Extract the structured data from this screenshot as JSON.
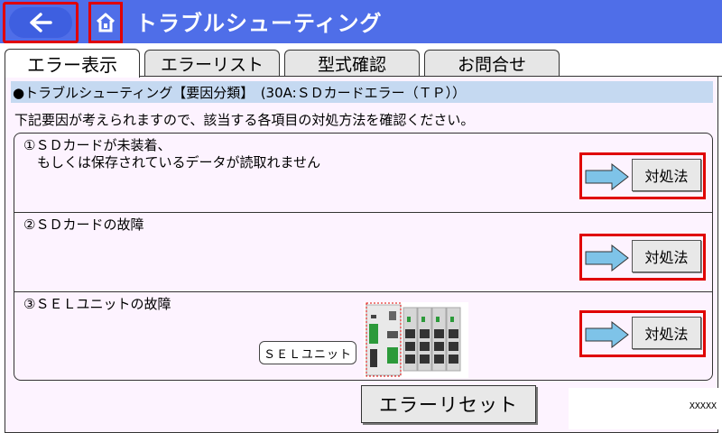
{
  "header": {
    "title": "トラブルシューティング",
    "back_icon": "arrow-left-icon",
    "home_icon": "home-icon",
    "bg_color": "#4f6ee8"
  },
  "tabs": [
    {
      "label": "エラー表示",
      "active": true
    },
    {
      "label": "エラーリスト",
      "active": false
    },
    {
      "label": "型式確認",
      "active": false
    },
    {
      "label": "お問合せ",
      "active": false
    }
  ],
  "main": {
    "category": "●トラブルシューティング【要因分類】　(30A:ＳＤカードエラー（ＴＰ））",
    "instruction": "下記要因が考えられますので、該当する各項目の対処方法を確認ください。",
    "causes": [
      {
        "line1": "①ＳＤカードが未装着、",
        "line2": "　もしくは保存されているデータが読取れません",
        "action_label": "対処法"
      },
      {
        "line1": "②ＳＤカードの故障",
        "line2": "",
        "action_label": "対処法"
      },
      {
        "line1": "③ＳＥＬユニットの故障",
        "line2": "",
        "action_label": "対処法"
      }
    ],
    "sel_unit_label": "ＳＥＬユニット",
    "reset_label": "エラーリセット",
    "code": "XXXXX"
  },
  "colors": {
    "highlight_red": "#e00000",
    "category_bar": "#c5d9f1",
    "panel_bg": "#fdf3ff"
  }
}
